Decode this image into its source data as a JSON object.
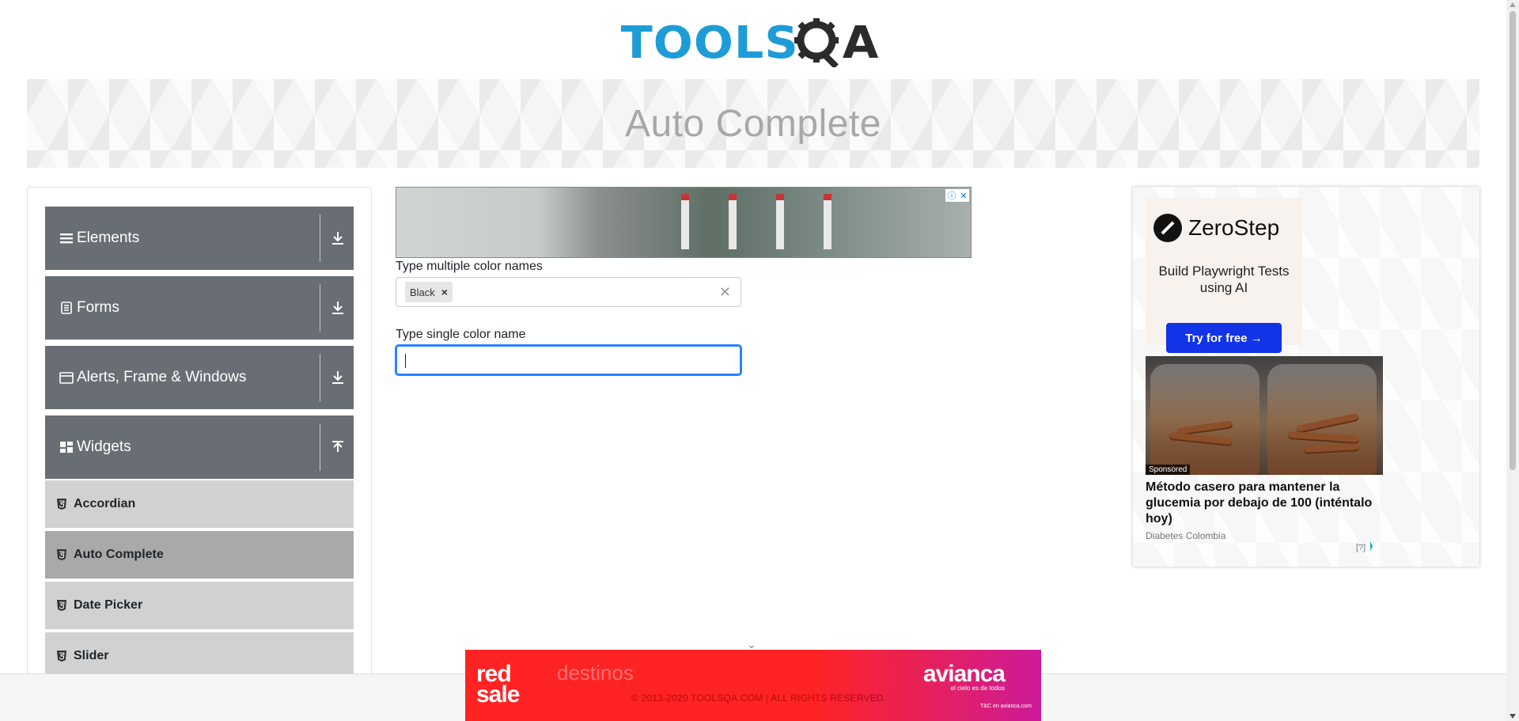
{
  "header": {
    "logo_tools": "TOOLS",
    "logo_qa": "A",
    "page_title": "Auto Complete"
  },
  "sidebar": {
    "groups": [
      {
        "label": "Elements",
        "icon": "menu-icon",
        "state": "collapsed"
      },
      {
        "label": "Forms",
        "icon": "document-icon",
        "state": "collapsed"
      },
      {
        "label": "Alerts, Frame & Windows",
        "icon": "window-icon",
        "state": "collapsed"
      },
      {
        "label": "Widgets",
        "icon": "grid-icon",
        "state": "expanded"
      }
    ],
    "widget_items": [
      {
        "label": "Accordian",
        "active": false
      },
      {
        "label": "Auto Complete",
        "active": true
      },
      {
        "label": "Date Picker",
        "active": false
      },
      {
        "label": "Slider",
        "active": false
      }
    ]
  },
  "form": {
    "multi_label": "Type multiple color names",
    "multi_chips": [
      "Black"
    ],
    "single_label": "Type single color name",
    "single_value": ""
  },
  "ads": {
    "right": {
      "brand": "ZeroStep",
      "tagline": "Build Playwright Tests using AI",
      "cta": "Try for free →",
      "badge": "Sponsored",
      "title": "Método casero para mantener la glucemia por debajo de 100 (inténtalo hoy)",
      "source": "Diabetes Colombia",
      "info": "[?]"
    },
    "bottom": {
      "red": "red",
      "sale": "sale",
      "destinos": "destinos",
      "brand": "avianca",
      "slogan": "el cielo es de todos",
      "tc": "T&C en avianca.com"
    }
  },
  "footer": {
    "copyright": "© 2013-2020 TOOLSQA.COM | ALL RIGHTS RESERVED."
  },
  "colors": {
    "brand_blue": "#1d9cd7",
    "sidebar_group": "#686e73",
    "sidebar_item": "#d1d1d1",
    "sidebar_item_active": "#a9a9a9",
    "focus_blue": "#2684ff",
    "cta_blue": "#1233e6"
  }
}
